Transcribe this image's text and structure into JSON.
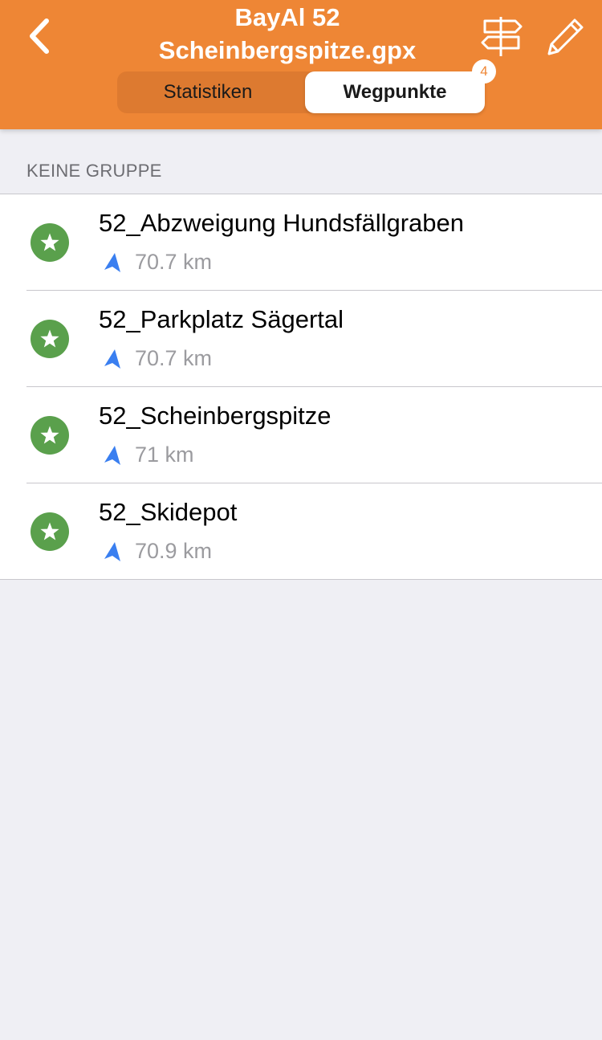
{
  "header": {
    "title_line1": "BayAl 52",
    "title_line2": "Scheinbergspitze.gpx",
    "background_color": "#ee8635"
  },
  "icons": {
    "back": "chevron-left-icon",
    "navigate": "signpost-icon",
    "edit": "pencil-icon",
    "favorite": "star-icon",
    "direction": "direction-arrow-icon"
  },
  "tabs": [
    {
      "label": "Statistiken",
      "selected": false
    },
    {
      "label": "Wegpunkte",
      "selected": true
    }
  ],
  "badge": {
    "count": "4"
  },
  "section": {
    "title": "KEINE GRUPPE"
  },
  "waypoints": [
    {
      "name": "52_Abzweigung Hundsfällgraben",
      "distance": "70.7 km"
    },
    {
      "name": "52_Parkplatz Sägertal",
      "distance": "70.7 km"
    },
    {
      "name": "52_Scheinbergspitze",
      "distance": "71 km"
    },
    {
      "name": "52_Skidepot",
      "distance": "70.9 km"
    }
  ],
  "colors": {
    "accent": "#ee8635",
    "favorite_green": "#5aa04c",
    "direction_blue": "#3a7ff0",
    "background": "#efeff4"
  }
}
